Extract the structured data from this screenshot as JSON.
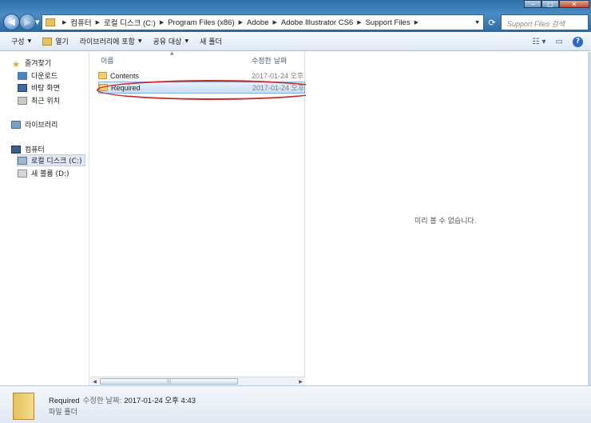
{
  "window": {
    "minimize_label": "−",
    "maximize_label": "□",
    "close_label": "✕"
  },
  "address": {
    "crumbs": [
      "컴퓨터",
      "로컬 디스크 (C:)",
      "Program Files (x86)",
      "Adobe",
      "Adobe Illustrator CS6",
      "Support Files"
    ]
  },
  "search": {
    "placeholder": "Support Files 검색"
  },
  "toolbar": {
    "organize": "구성",
    "open": "열기",
    "include_library": "라이브러리에 포함",
    "share": "공유 대상",
    "new_folder": "새 폴더"
  },
  "nav": {
    "favorites": "즐겨찾기",
    "downloads": "다운로드",
    "desktop": "바탕 화면",
    "recent": "최근 위치",
    "libraries": "라이브러리",
    "computer": "컴퓨터",
    "local_disk": "로컬 디스크 (C:)",
    "new_volume": "새 볼륨 (D:)"
  },
  "filelist": {
    "col_name": "이름",
    "col_date": "수정한 날짜",
    "rows": [
      {
        "name": "Contents",
        "date": "2017-01-24 오후"
      },
      {
        "name": "Required",
        "date": "2017-01-24 오후"
      }
    ],
    "scroll_grip": "|||"
  },
  "preview": {
    "message": "미리 볼 수 없습니다."
  },
  "details": {
    "name": "Required",
    "date_label": "수정한 날짜:",
    "date_value": "2017-01-24 오후 4:43",
    "type": "파일 폴더"
  },
  "colors": {
    "highlight_ellipse": "#c42a2a",
    "titlebar": "#2f6fa7",
    "selection": "#c9dff6"
  }
}
